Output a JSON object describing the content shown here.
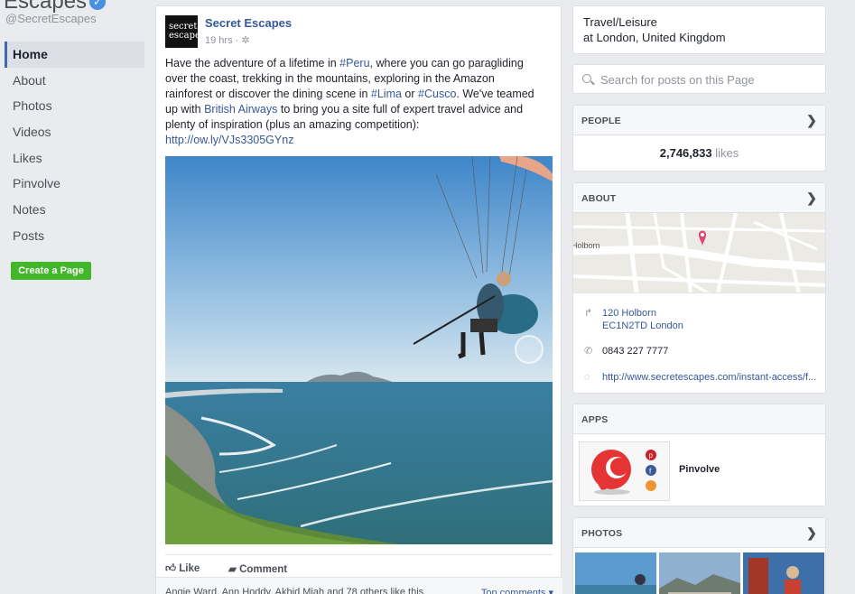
{
  "sidebar": {
    "page_name": "Escapes",
    "handle": "@SecretEscapes",
    "nav": [
      "Home",
      "About",
      "Photos",
      "Videos",
      "Likes",
      "Pinvolve",
      "Notes",
      "Posts"
    ],
    "create_page": "Create a Page"
  },
  "post": {
    "author": "Secret Escapes",
    "avatar_text": "secret escapes",
    "time": "19 hrs",
    "text_parts": [
      "Have the adventure of a lifetime in ",
      "#Peru",
      ", where you can go paragliding over the coast, trekking in the mountains, exploring in the Amazon rainforest or discover the dining scene in ",
      "#Lima",
      " or ",
      "#Cusco",
      ". We've teamed up with ",
      "British Airways",
      " to bring you a site full of expert travel advice and plenty of inspiration (plus an amazing competition): "
    ],
    "link": "http://ow.ly/VJs3305GYnz",
    "like_label": "Like",
    "comment_label": "Comment",
    "likes_summary": "Angie Ward, Ann Hoddy, Akhid Miah and 78 others like this.",
    "top_comments": "Top comments ▾"
  },
  "right": {
    "category": "Travel/Leisure",
    "location": "at London, United Kingdom",
    "search_placeholder": "Search for posts on this Page",
    "people_header": "PEOPLE",
    "likes_count": "2,746,833",
    "likes_word": "likes",
    "about_header": "ABOUT",
    "map_label_holborn": "Holborn",
    "address_line1": "120 Holborn",
    "address_line2": "EC1N2TD London",
    "phone": "0843 227 7777",
    "website": "http://www.secretescapes.com/instant-access/f...",
    "apps_header": "APPS",
    "app_name": "Pinvolve",
    "photos_header": "PHOTOS"
  },
  "colors": {
    "link": "#365899",
    "create_button": "#42b72a",
    "map_pin": "#e0457b",
    "app_bubble": "#e53434"
  }
}
